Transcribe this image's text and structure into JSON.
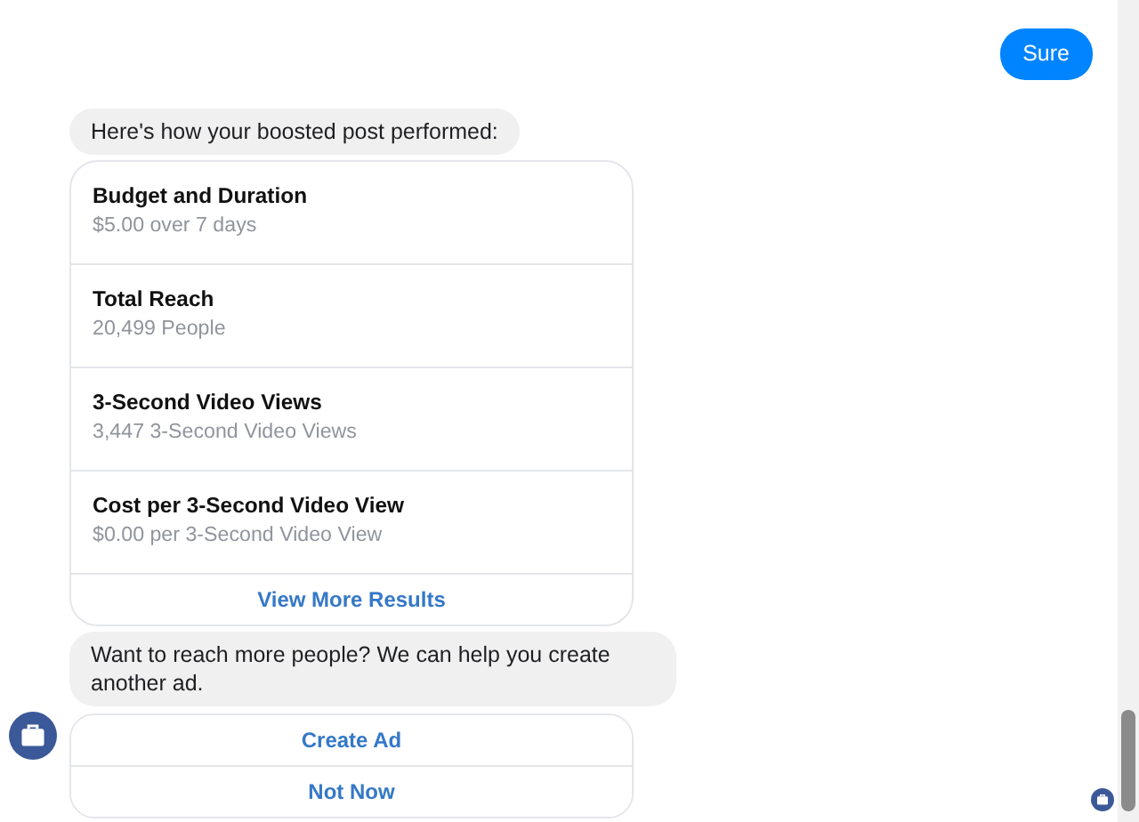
{
  "sent_message": {
    "text": "Sure"
  },
  "received_message": {
    "text": "Here's how your boosted post performed:"
  },
  "results_card": {
    "rows": [
      {
        "title": "Budget and Duration",
        "value": "$5.00 over 7 days"
      },
      {
        "title": "Total Reach",
        "value": "20,499 People"
      },
      {
        "title": "3-Second Video Views",
        "value": "3,447 3-Second Video Views"
      },
      {
        "title": "Cost per 3-Second Video View",
        "value": "$0.00 per 3-Second Video View"
      }
    ],
    "link": "View More Results"
  },
  "follow_up_message": {
    "text": "Want to reach more people? We can help you create another ad."
  },
  "quick_replies": [
    "Create Ad",
    "Not Now"
  ]
}
